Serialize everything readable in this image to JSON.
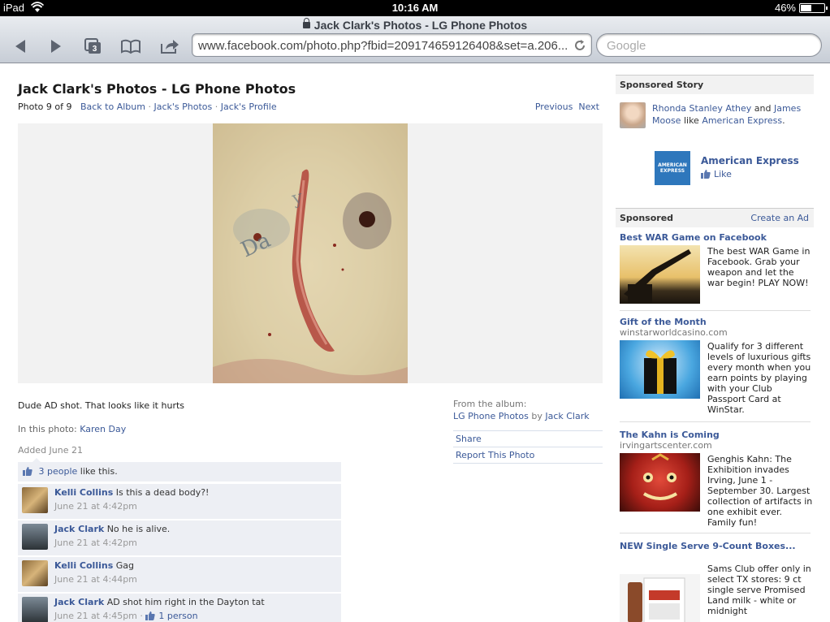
{
  "status": {
    "carrier": "iPad",
    "time": "10:16 AM",
    "battery": "46%",
    "battery_level": 0.46
  },
  "browser": {
    "page_title": "Jack Clark's Photos - LG Phone Photos",
    "tab_count": "3",
    "url": "www.facebook.com/photo.php?fbid=209174659126408&set=a.206...",
    "search_placeholder": "Google"
  },
  "photo_page": {
    "title": "Jack Clark's Photos - LG Phone Photos",
    "position": "Photo 9 of 9",
    "links": [
      "Back to Album",
      "Jack's Photos",
      "Jack's Profile"
    ],
    "separator": "·",
    "previous": "Previous",
    "next": "Next",
    "caption": "Dude AD shot. That looks like it hurts",
    "in_photo_label": "In this photo:",
    "in_photo_name": "Karen Day",
    "added": "Added June 21",
    "from_album_label": "From the album:",
    "album_name": "LG Phone Photos",
    "by": "by",
    "album_owner": "Jack Clark",
    "actions": [
      "Share",
      "Report This Photo"
    ],
    "likes_count": "3 people",
    "likes_text": "like this."
  },
  "comments": [
    {
      "author": "Kelli Collins",
      "text": "Is this a dead body?!",
      "time": "June 21 at 4:42pm",
      "extra": ""
    },
    {
      "author": "Jack Clark",
      "text": "No he is alive.",
      "time": "June 21 at 4:42pm",
      "extra": ""
    },
    {
      "author": "Kelli Collins",
      "text": "Gag",
      "time": "June 21 at 4:44pm",
      "extra": ""
    },
    {
      "author": "Jack Clark",
      "text": "AD shot him right in the Dayton tat",
      "time": "June 21 at 4:45pm",
      "extra": "1 person"
    }
  ],
  "sidebar": {
    "sponsored_story_header": "Sponsored Story",
    "story": {
      "person1": "Rhonda Stanley Athey",
      "and": "and",
      "person2": "James Moose",
      "like": "like",
      "brand": "American Express",
      "period": ".",
      "logo_text": "AMERICAN EXPRESS",
      "brand_name": "American Express",
      "like_label": "Like"
    },
    "sponsored_header": "Sponsored",
    "create_ad": "Create an Ad",
    "ads": [
      {
        "title": "Best WAR Game on Facebook",
        "url": "",
        "desc": "The best WAR Game in Facebook. Grab your weapon and let the war begin! PLAY NOW!"
      },
      {
        "title": "Gift of the Month",
        "url": "winstarworldcasino.com",
        "desc": "Qualify for 3 different levels of luxurious gifts every month when you earn points by playing with your Club Passport Card at WinStar."
      },
      {
        "title": "The Kahn is Coming",
        "url": "irvingartscenter.com",
        "desc": "Genghis Kahn: The Exhibition invades Irving, June 1 - September 30. Largest collection of artifacts in one exhibit ever. Family fun!"
      },
      {
        "title": "NEW Single Serve 9-Count Boxes...",
        "url": "",
        "desc": "Sams Club offer only in select TX stores: 9 ct single serve Promised Land milk - white or midnight"
      }
    ]
  }
}
